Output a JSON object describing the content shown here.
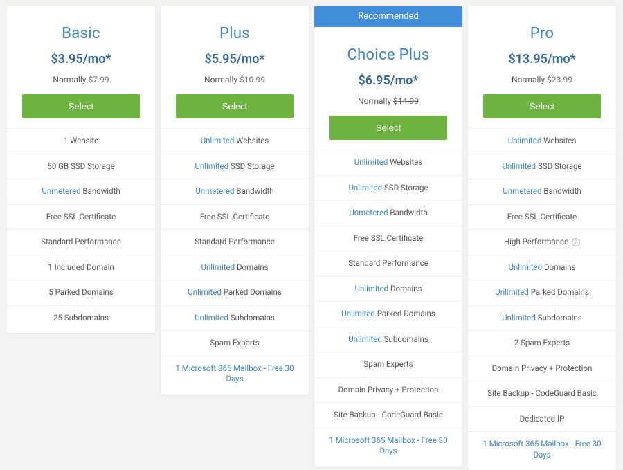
{
  "recommended_label": "Recommended",
  "normally_prefix": "Normally",
  "select_label": "Select",
  "info_glyph": "?",
  "plans": [
    {
      "id": "basic",
      "name": "Basic",
      "price": "$3.95/mo*",
      "normal_price": "$7.99",
      "features": [
        {
          "text": "1 Website"
        },
        {
          "text": "50 GB SSD Storage"
        },
        {
          "highlight": "Unmetered",
          "text": " Bandwidth"
        },
        {
          "text": "Free SSL Certificate"
        },
        {
          "text": "Standard Performance"
        },
        {
          "text": "1 Included Domain"
        },
        {
          "text": "5 Parked Domains"
        },
        {
          "text": "25 Subdomains"
        }
      ]
    },
    {
      "id": "plus",
      "name": "Plus",
      "price": "$5.95/mo*",
      "normal_price": "$10.99",
      "features": [
        {
          "highlight": "Unlimited",
          "text": " Websites"
        },
        {
          "highlight": "Unlimited",
          "text": " SSD Storage"
        },
        {
          "highlight": "Unmetered",
          "text": " Bandwidth"
        },
        {
          "text": "Free SSL Certificate"
        },
        {
          "text": "Standard Performance"
        },
        {
          "highlight": "Unlimited",
          "text": " Domains"
        },
        {
          "highlight": "Unlimited",
          "text": " Parked Domains"
        },
        {
          "highlight": "Unlimited",
          "text": " Subdomains"
        },
        {
          "text": "Spam Experts"
        },
        {
          "all_highlight": true,
          "text": "1 Microsoft 365 Mailbox - Free 30 Days"
        }
      ]
    },
    {
      "id": "choice-plus",
      "name": "Choice Plus",
      "price": "$6.95/mo*",
      "normal_price": "$14.99",
      "recommended": true,
      "features": [
        {
          "highlight": "Unlimited",
          "text": " Websites"
        },
        {
          "highlight": "Unlimited",
          "text": " SSD Storage"
        },
        {
          "highlight": "Unmetered",
          "text": " Bandwidth"
        },
        {
          "text": "Free SSL Certificate"
        },
        {
          "text": "Standard Performance"
        },
        {
          "highlight": "Unlimited",
          "text": " Domains"
        },
        {
          "highlight": "Unlimited",
          "text": " Parked Domains"
        },
        {
          "highlight": "Unlimited",
          "text": " Subdomains"
        },
        {
          "text": "Spam Experts"
        },
        {
          "text": "Domain Privacy + Protection"
        },
        {
          "text": "Site Backup - CodeGuard Basic"
        },
        {
          "all_highlight": true,
          "text": "1 Microsoft 365 Mailbox - Free 30 Days"
        }
      ]
    },
    {
      "id": "pro",
      "name": "Pro",
      "price": "$13.95/mo*",
      "normal_price": "$23.99",
      "features": [
        {
          "highlight": "Unlimited",
          "text": " Websites"
        },
        {
          "highlight": "Unlimited",
          "text": " SSD Storage"
        },
        {
          "highlight": "Unmetered",
          "text": " Bandwidth"
        },
        {
          "text": "Free SSL Certificate"
        },
        {
          "text": "High Performance",
          "info": true
        },
        {
          "highlight": "Unlimited",
          "text": " Domains"
        },
        {
          "highlight": "Unlimited",
          "text": " Parked Domains"
        },
        {
          "highlight": "Unlimited",
          "text": " Subdomains"
        },
        {
          "text": "2 Spam Experts"
        },
        {
          "text": "Domain Privacy + Protection"
        },
        {
          "text": "Site Backup - CodeGuard Basic"
        },
        {
          "text": "Dedicated IP"
        },
        {
          "all_highlight": true,
          "text": "1 Microsoft 365 Mailbox - Free 30 Days"
        }
      ]
    }
  ]
}
